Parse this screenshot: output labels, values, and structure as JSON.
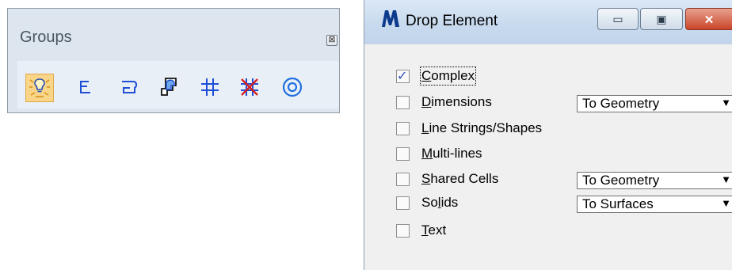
{
  "groups_panel": {
    "title": "Groups",
    "close_glyph": "⊠",
    "tools": [
      {
        "name": "drop-element-tool-icon",
        "active": true
      },
      {
        "name": "create-complex-chain-tool-icon"
      },
      {
        "name": "create-complex-shape-tool-icon"
      },
      {
        "name": "create-region-tool-icon"
      },
      {
        "name": "add-to-graphic-group-tool-icon"
      },
      {
        "name": "drop-from-graphic-group-tool-icon"
      },
      {
        "name": "group-holes-tool-icon"
      }
    ]
  },
  "dialog": {
    "title": "Drop Element",
    "buttons": {
      "minimize": "▭",
      "maximize": "▣",
      "close": "✕"
    },
    "options": [
      {
        "prefix": "",
        "mnemonic": "C",
        "suffix": "omplex",
        "checked": true,
        "focused": true
      },
      {
        "prefix": "",
        "mnemonic": "D",
        "suffix": "imensions",
        "checked": false,
        "dropdown": "To Geometry"
      },
      {
        "prefix": "",
        "mnemonic": "L",
        "suffix": "ine Strings/Shapes",
        "checked": false
      },
      {
        "prefix": "",
        "mnemonic": "M",
        "suffix": "ulti-lines",
        "checked": false
      },
      {
        "prefix": "",
        "mnemonic": "S",
        "suffix": "hared Cells",
        "checked": false,
        "dropdown": "To Geometry"
      },
      {
        "prefix": "So",
        "mnemonic": "l",
        "suffix": "ids",
        "checked": false,
        "dropdown": "To Surfaces"
      },
      {
        "prefix": "",
        "mnemonic": "T",
        "suffix": "ext",
        "checked": false
      }
    ],
    "checkmark": "✓",
    "dropdown_arrow": "▼"
  },
  "colors": {
    "panel_bg": "#dde6ef",
    "active_tool": "#f8d587",
    "icon_blue": "#1f4fd6",
    "icon_red": "#d62020"
  }
}
